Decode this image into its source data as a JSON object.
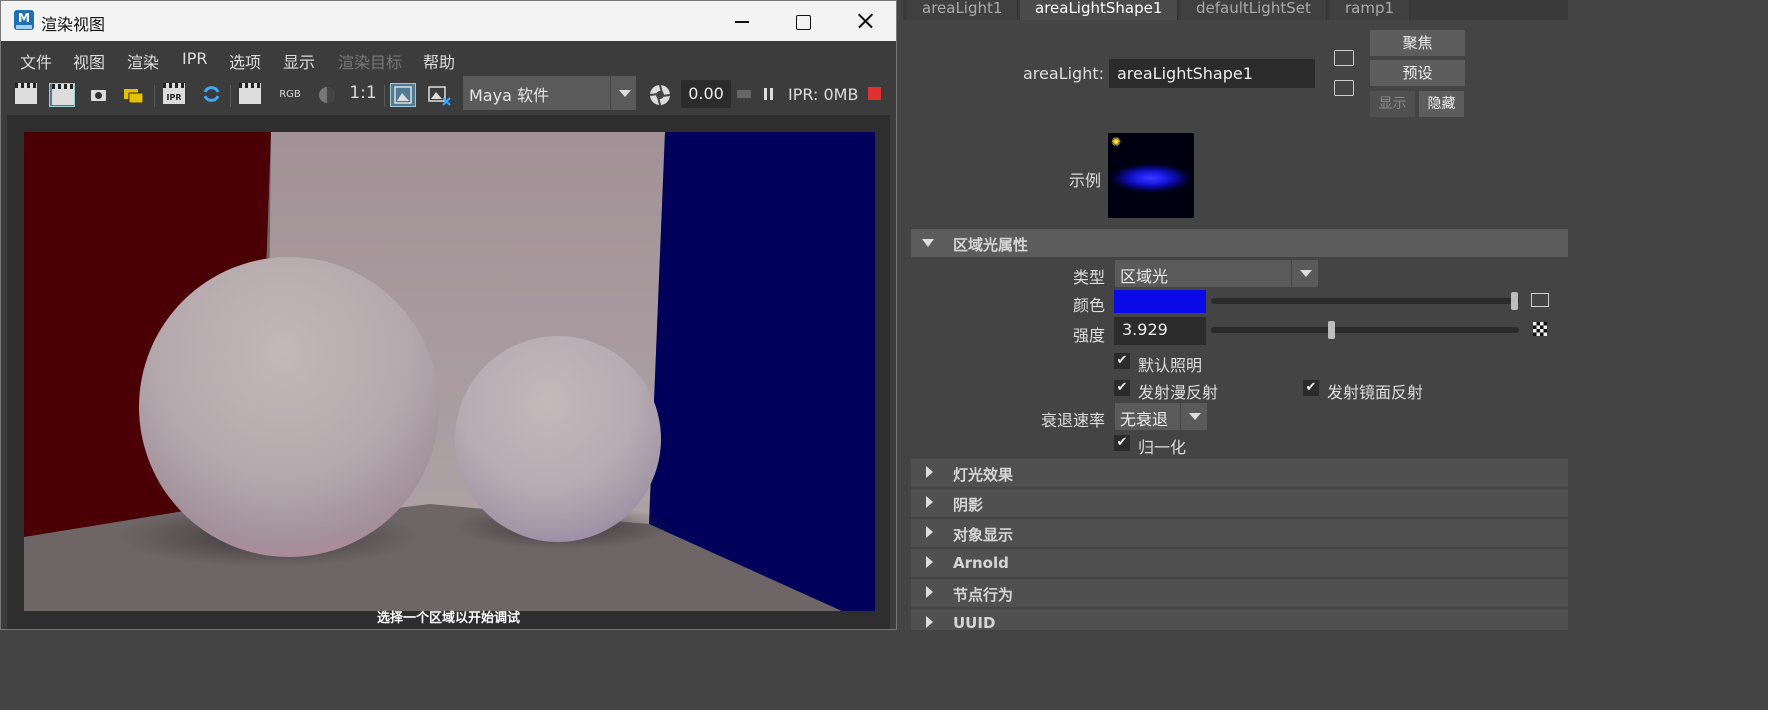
{
  "window": {
    "title": "渲染视图",
    "app_icon": "maya-app-icon"
  },
  "menu": {
    "items": [
      {
        "label": "文件",
        "enabled": true
      },
      {
        "label": "视图",
        "enabled": true
      },
      {
        "label": "渲染",
        "enabled": true
      },
      {
        "label": "IPR",
        "enabled": true
      },
      {
        "label": "选项",
        "enabled": true
      },
      {
        "label": "显示",
        "enabled": true
      },
      {
        "label": "渲染目标",
        "enabled": false
      },
      {
        "label": "帮助",
        "enabled": true
      }
    ]
  },
  "toolbar": {
    "rgb_label": "RGB",
    "ratio_label": "1:1",
    "ipr_label": "IPR",
    "renderer": "Maya 软件",
    "exposure": "0.00",
    "ipr_memory": "IPR: 0MB"
  },
  "viewport": {
    "status": "选择一个区域以开始调试"
  },
  "attribute_editor": {
    "tabs": [
      {
        "label": "areaLight1",
        "active": false
      },
      {
        "label": "areaLightShape1",
        "active": true
      },
      {
        "label": "defaultLightSet",
        "active": false
      },
      {
        "label": "ramp1",
        "active": false
      }
    ],
    "node_type_label": "areaLight:",
    "node_name": "areaLightShape1",
    "buttons": {
      "focus": "聚焦",
      "presets": "预设",
      "show": "显示",
      "hide": "隐藏"
    },
    "swatch_label": "示例",
    "sections": {
      "area_light_attributes": "区域光属性",
      "light_effects": "灯光效果",
      "shadows": "阴影",
      "object_display": "对象显示",
      "arnold": "Arnold",
      "node_behavior": "节点行为",
      "uuid": "UUID"
    },
    "attributes": {
      "type_label": "类型",
      "type_value": "区域光",
      "color_label": "颜色",
      "color_value": "#0a0ae6",
      "intensity_label": "强度",
      "intensity_value": "3.929",
      "intensity_slider_fraction": 0.39,
      "illuminates_default_label": "默认照明",
      "illuminates_default": true,
      "emit_diffuse_label": "发射漫反射",
      "emit_diffuse": true,
      "emit_specular_label": "发射镜面反射",
      "emit_specular": true,
      "decay_rate_label": "衰退速率",
      "decay_rate_value": "无衰退",
      "normalize_label": "归一化",
      "normalize": true
    }
  },
  "colors": {
    "scene_left_wall": "#4a0004",
    "scene_right_wall": "#00005a",
    "scene_back_wall": "#a7979c",
    "scene_floor": "#6d6566",
    "stop_button": "#e0302f",
    "active_tab": "#4b4b4b"
  }
}
